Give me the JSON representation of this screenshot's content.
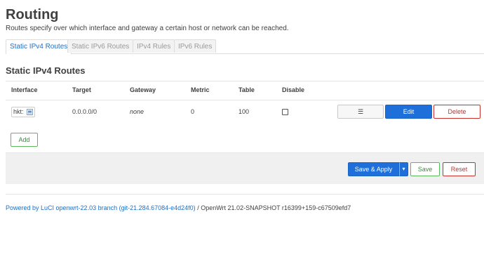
{
  "page": {
    "title": "Routing",
    "description": "Routes specify over which interface and gateway a certain host or network can be reached."
  },
  "tabs": [
    {
      "label": "Static IPv4 Routes",
      "active": true
    },
    {
      "label": "Static IPv6 Routes",
      "active": false
    },
    {
      "label": "IPv4 Rules",
      "active": false
    },
    {
      "label": "IPv6 Rules",
      "active": false
    }
  ],
  "section": {
    "title": "Static IPv4 Routes",
    "columns": [
      "Interface",
      "Target",
      "Gateway",
      "Metric",
      "Table",
      "Disable"
    ],
    "rows": [
      {
        "interface": "hkt:",
        "target": "0.0.0.0/0",
        "gateway": "none",
        "metric": "0",
        "table": "100",
        "disable": false,
        "drag_label": "☰",
        "edit_label": "Edit",
        "delete_label": "Delete"
      }
    ],
    "add_label": "Add"
  },
  "actions": {
    "save_apply_label": "Save & Apply",
    "save_apply_caret": "▾",
    "save_label": "Save",
    "reset_label": "Reset"
  },
  "footer": {
    "link_text": "Powered by LuCI openwrt-22.03 branch (git-21.284.67084-e4d24f0)",
    "suffix": "/ OpenWrt 21.02-SNAPSHOT r16399+159-c67509efd7"
  },
  "colors": {
    "accent": "#1e6fd9",
    "link": "#1f6fc5",
    "positive": "#5cb85c",
    "negative": "#c9302c"
  },
  "icons": {
    "interface": "network-port-icon",
    "drag": "drag-handle-icon"
  }
}
